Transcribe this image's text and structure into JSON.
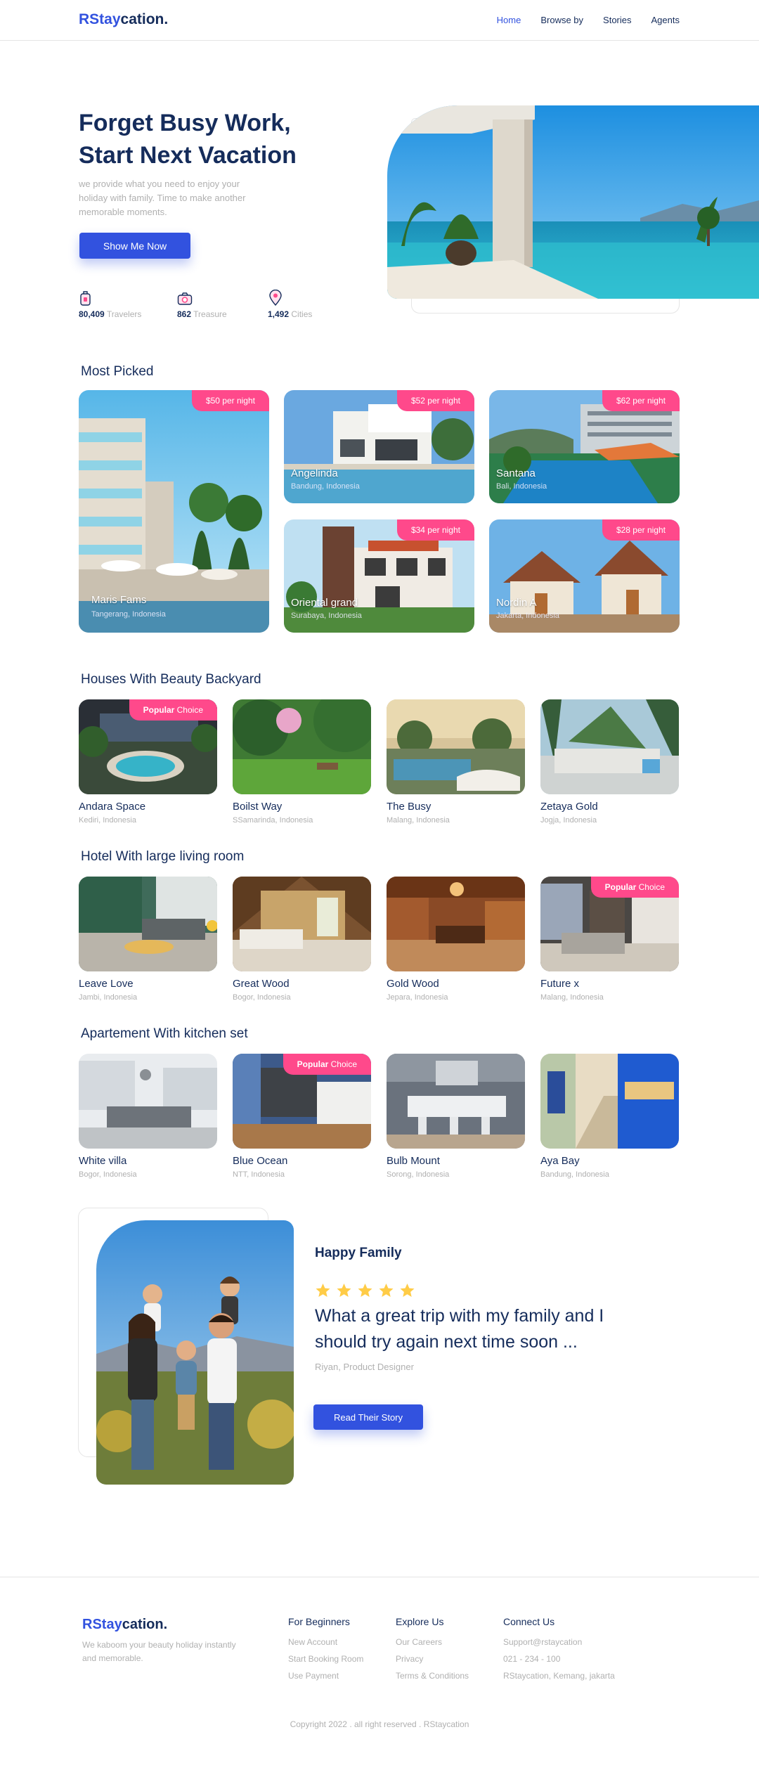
{
  "brand": {
    "prefix": "RStay",
    "suffix": "cation."
  },
  "colors": {
    "primary": "#3252DF",
    "navy": "#152C5B",
    "pink": "#FF498B",
    "gray": "#B0B0B0",
    "star": "#FFCC47"
  },
  "nav": {
    "items": [
      "Home",
      "Browse by",
      "Stories",
      "Agents"
    ],
    "active": "Home"
  },
  "hero": {
    "title_line1": "Forget Busy Work,",
    "title_line2": "Start Next Vacation",
    "subtitle": "we provide what you need to enjoy your holiday with family. Time to make another memorable moments.",
    "button": "Show Me Now",
    "stats": [
      {
        "icon": "traveler-luggage-icon",
        "value": "80,409",
        "label": "Travelers"
      },
      {
        "icon": "camera-icon",
        "value": "862",
        "label": "Treasure"
      },
      {
        "icon": "map-pin-icon",
        "value": "1,492",
        "label": "Cities"
      }
    ]
  },
  "most_picked": {
    "title": "Most Picked",
    "items": [
      {
        "price": "$50 per night",
        "name": "Maris Fams",
        "location": "Tangerang, Indonesia"
      },
      {
        "price": "$52 per night",
        "name": "Angelinda",
        "location": "Bandung, Indonesia"
      },
      {
        "price": "$62 per night",
        "name": "Santana",
        "location": "Bali, Indonesia"
      },
      {
        "price": "$34 per night",
        "name": "Oriental grand",
        "location": "Surabaya, Indonesia"
      },
      {
        "price": "$28 per night",
        "name": "Nordin A",
        "location": "Jakarta, Indonesia"
      }
    ]
  },
  "badge": {
    "strong": "Popular",
    "rest": "Choice"
  },
  "categories": [
    {
      "title": "Houses With Beauty Backyard",
      "items": [
        {
          "name": "Andara Space",
          "location": "Kediri, Indonesia",
          "popular": true
        },
        {
          "name": "Boilst Way",
          "location": "SSamarinda, Indonesia",
          "popular": false
        },
        {
          "name": "The Busy",
          "location": "Malang, Indonesia",
          "popular": false
        },
        {
          "name": "Zetaya Gold",
          "location": "Jogja, Indonesia",
          "popular": false
        }
      ]
    },
    {
      "title": "Hotel With large living room",
      "items": [
        {
          "name": "Leave Love",
          "location": "Jambi, Indonesia",
          "popular": false
        },
        {
          "name": "Great Wood",
          "location": "Bogor, Indonesia",
          "popular": false
        },
        {
          "name": "Gold Wood",
          "location": "Jepara, Indonesia",
          "popular": false
        },
        {
          "name": "Future x",
          "location": "Malang, Indonesia",
          "popular": true
        }
      ]
    },
    {
      "title": "Apartement With kitchen set",
      "items": [
        {
          "name": "White villa",
          "location": "Bogor, Indonesia",
          "popular": false
        },
        {
          "name": "Blue Ocean",
          "location": "NTT, Indonesia",
          "popular": true
        },
        {
          "name": "Bulb Mount",
          "location": "Sorong, Indonesia",
          "popular": false
        },
        {
          "name": "Aya Bay",
          "location": "Bandung, Indonesia",
          "popular": false
        }
      ]
    }
  ],
  "testimonial": {
    "heading": "Happy Family",
    "rating": 5,
    "quote": "What a great trip with my family and I should try again next time soon ...",
    "author": "Riyan, Product Designer",
    "button": "Read Their Story"
  },
  "footer": {
    "description": "We kaboom your beauty holiday instantly and memorable.",
    "columns": [
      {
        "title": "For Beginners",
        "links": [
          "New Account",
          "Start Booking Room",
          "Use Payment"
        ]
      },
      {
        "title": "Explore Us",
        "links": [
          "Our Careers",
          "Privacy",
          "Terms & Conditions"
        ]
      },
      {
        "title": "Connect Us",
        "links": [
          "Support@rstaycation",
          "021 - 234 - 100",
          "RStaycation, Kemang, jakarta"
        ]
      }
    ],
    "copyright": "Copyright 2022 . all right reserved . RStaycation"
  }
}
